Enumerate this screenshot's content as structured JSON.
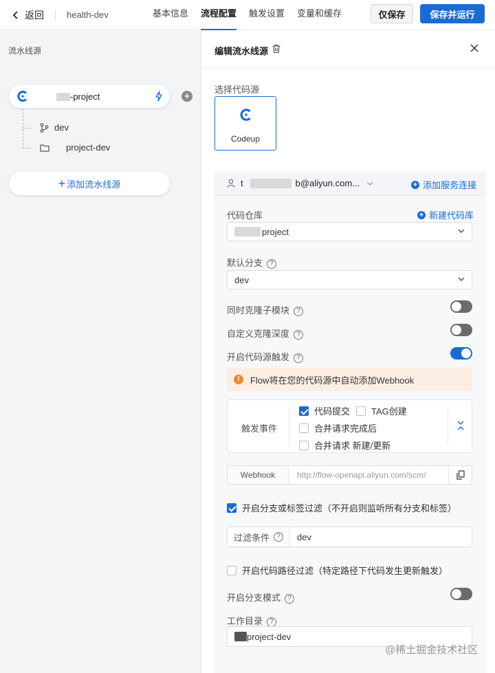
{
  "topbar": {
    "back_label": "返回",
    "project_name": "health-dev",
    "tabs": [
      {
        "label": "基本信息",
        "active": false
      },
      {
        "label": "流程配置",
        "active": true
      },
      {
        "label": "触发设置",
        "active": false
      },
      {
        "label": "变量和缓存",
        "active": false
      }
    ],
    "save_label": "仅保存",
    "save_run_label": "保存并运行"
  },
  "sidebar": {
    "title": "流水线源",
    "source": {
      "name_suffix": "-project"
    },
    "branch": "dev",
    "workdir": "project-dev",
    "add_source_label": "添加流水线源"
  },
  "editor": {
    "title": "编辑流水线源",
    "select_source_label": "选择代码源",
    "source_option": "Codeup",
    "account_suffix": "b@aliyun.com...",
    "account_prefix": "t",
    "add_connection_label": "添加服务连接",
    "repo_label": "代码仓库",
    "new_repo_label": "新建代码库",
    "repo_value_suffix": "project",
    "default_branch_label": "默认分支",
    "default_branch_value": "dev",
    "clone_submodule_label": "同时克隆子模块",
    "clone_submodule_on": false,
    "custom_depth_label": "自定义克隆深度",
    "custom_depth_on": false,
    "trigger_label": "开启代码源触发",
    "trigger_on": true,
    "webhook_notice": "Flow将在您的代码源中自动添加Webhook",
    "events_label": "触发事件",
    "events": [
      {
        "label": "代码提交",
        "checked": true
      },
      {
        "label": "TAG创建",
        "checked": false
      },
      {
        "label": "合并请求完成后",
        "checked": false
      },
      {
        "label": "合并请求 新建/更新",
        "checked": false
      }
    ],
    "webhook_label": "Webhook",
    "webhook_value": "http://flow-openapi.aliyun.com/scm/",
    "branch_filter_label": "开启分支或标签过滤（不开启则监听所有分支和标签）",
    "branch_filter_checked": true,
    "filter_condition_label": "过滤条件",
    "filter_condition_value": "dev",
    "path_filter_label": "开启代码路径过滤（特定路径下代码发生更新触发）",
    "path_filter_checked": false,
    "branch_mode_label": "开启分支模式",
    "branch_mode_on": false,
    "workdir_label": "工作目录",
    "workdir_value": "project-dev"
  },
  "watermark": "@稀土掘金技术社区",
  "colors": {
    "accent": "#1b6bd6",
    "warning": "#ea8a2c",
    "warning_bg": "#fdeee4"
  },
  "icons": [
    "back-arrow-icon",
    "codeup-logo-icon",
    "bolt-icon",
    "branch-icon",
    "folder-icon",
    "trash-icon",
    "close-icon",
    "user-icon",
    "chevron-down-icon",
    "help-icon",
    "warning-icon",
    "collapse-icon",
    "copy-icon"
  ]
}
